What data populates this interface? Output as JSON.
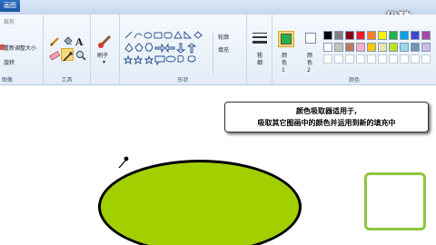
{
  "titlebar": {
    "home_tab": "画图"
  },
  "watermark": "优酷",
  "ribbon": {
    "image_group": {
      "label": "图像",
      "crop": "裁剪",
      "resize": "重新调整大小",
      "rotate": "旋转"
    },
    "tools_group": {
      "label": "工具"
    },
    "brushes_label": "刷子",
    "shapes_group": {
      "label": "形状",
      "outline": "轮廓",
      "fill": "填充"
    },
    "size_label": "粗细",
    "colors_group": {
      "label": "颜色",
      "color1_label": "颜色 1",
      "color2_label": "颜色 2",
      "color1": "#22b14c",
      "color2": "#ffffff",
      "palette": [
        "#000000",
        "#7f7f7f",
        "#880015",
        "#ed1c24",
        "#ff7f27",
        "#fff200",
        "#22b14c",
        "#00a2e8",
        "#3f48cc",
        "#a349a4",
        "#ffffff",
        "#c3c3c3",
        "#b97a57",
        "#ffaec9",
        "#ffc90e",
        "#efe4b0",
        "#b5e61d",
        "#99d9ea",
        "#7092be",
        "#c8bfe7"
      ]
    }
  },
  "tooltip": {
    "line1": "颜色吸取器适用于,",
    "line2": "吸取其它图画中的颜色并运用到新的填充中"
  },
  "canvas": {
    "ellipse_fill": "#a2cf00",
    "rect_outline": "#8dc63f"
  }
}
